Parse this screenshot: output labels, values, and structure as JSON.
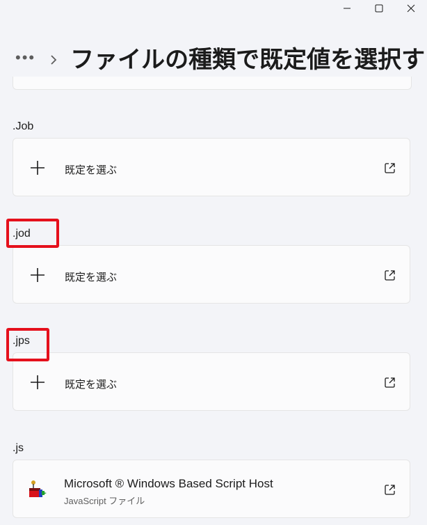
{
  "header": {
    "more_label": "•••",
    "title": "ファイルの種類で既定値を選択する"
  },
  "sections": [
    {
      "label": ".Job",
      "action_label": "既定を選ぶ"
    },
    {
      "label": ".jod",
      "action_label": "既定を選ぶ"
    },
    {
      "label": ".jps",
      "action_label": "既定を選ぶ"
    },
    {
      "label": ".js",
      "app_name": "Microsoft ® Windows Based Script Host",
      "app_sub": "JavaScript ファイル"
    }
  ],
  "colors": {
    "background": "#f3f4f8",
    "card": "#fbfbfc",
    "highlight": "#e5101c"
  },
  "icons": {
    "minimize": "minimize-icon",
    "maximize": "maximize-icon",
    "close": "close-icon",
    "plus": "plus-icon",
    "open_external": "open-external-icon",
    "app": "script-host-icon"
  }
}
